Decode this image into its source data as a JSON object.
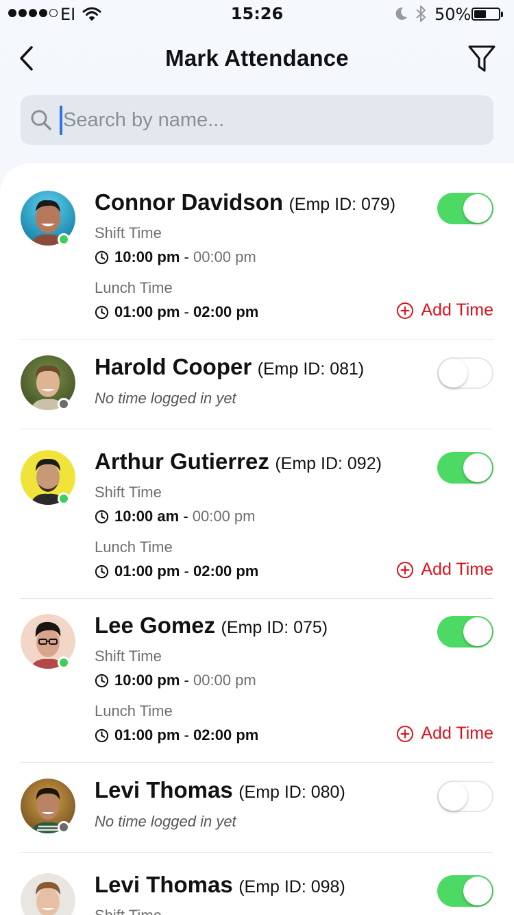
{
  "status_bar": {
    "carrier": "EI",
    "time": "15:26",
    "battery_percent": "50%",
    "battery_level": 0.5,
    "signal_bars": 4,
    "signal_total": 5
  },
  "header": {
    "title": "Mark Attendance",
    "back_icon": "chevron-left-icon",
    "filter_icon": "filter-icon"
  },
  "search": {
    "placeholder": "Search by name...",
    "value": ""
  },
  "colors": {
    "toggle_on": "#4cd964",
    "online_dot": "#3ccf5a",
    "offline_dot": "#6b6b6b",
    "add_time": "#e0101b",
    "caret": "#2b73e6"
  },
  "labels": {
    "shift_time": "Shift Time",
    "lunch_time": "Lunch Time",
    "add_time": "Add Time",
    "no_time": "No time logged in yet",
    "time_separator": "-"
  },
  "employees": [
    {
      "name": "Connor Davidson",
      "emp_id": "(Emp ID: 079)",
      "online": true,
      "present": true,
      "shift_start": "10:00 pm",
      "shift_end": "00:00 pm",
      "lunch_start": "01:00 pm",
      "lunch_end": "02:00 pm"
    },
    {
      "name": "Harold Cooper",
      "emp_id": "(Emp ID: 081)",
      "online": false,
      "present": false
    },
    {
      "name": "Arthur Gutierrez",
      "emp_id": "(Emp ID: 092)",
      "online": true,
      "present": true,
      "shift_start": "10:00 am",
      "shift_end": "00:00 pm",
      "lunch_start": "01:00 pm",
      "lunch_end": "02:00 pm"
    },
    {
      "name": "Lee Gomez",
      "emp_id": "(Emp ID: 075)",
      "online": true,
      "present": true,
      "shift_start": "10:00 pm",
      "shift_end": "00:00 pm",
      "lunch_start": "01:00 pm",
      "lunch_end": "02:00 pm"
    },
    {
      "name": "Levi Thomas",
      "emp_id": "(Emp ID: 080)",
      "online": false,
      "present": false
    },
    {
      "name": "Levi Thomas",
      "emp_id": "(Emp ID: 098)",
      "online": true,
      "present": true
    }
  ]
}
